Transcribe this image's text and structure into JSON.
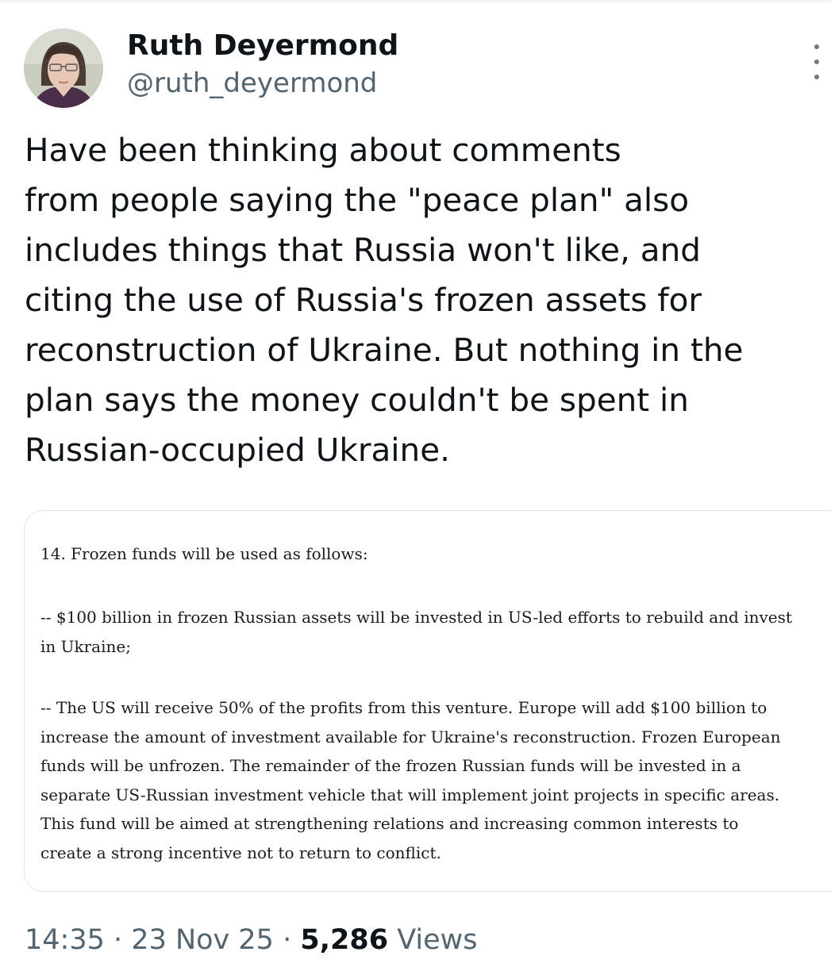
{
  "author": {
    "name": "Ruth Deyermond",
    "handle": "@ruth_deyermond"
  },
  "tweet": {
    "text": "Have been thinking about comments\nfrom people saying the \"peace plan\" also\nincludes things that Russia won't like, and\nciting the use of Russia's frozen assets for\nreconstruction of Ukraine. But nothing in the\nplan says the money couldn't be spent in\nRussian-occupied Ukraine."
  },
  "quoted_image": {
    "heading": "14. Frozen funds will be used as follows:",
    "paragraph1": "-- $100 billion in frozen Russian assets will be invested in US-led efforts to rebuild and invest in Ukraine;",
    "paragraph2": "-- The US will receive 50% of the profits from this venture. Europe will add $100 billion to increase the amount of investment available for Ukraine's reconstruction. Frozen European funds will be unfrozen. The remainder of the frozen Russian funds will be invested in a separate US-Russian investment vehicle that will implement joint projects in specific areas. This fund will be aimed at strengthening relations and increasing common interests to create a strong incentive not to return to conflict."
  },
  "meta": {
    "time": "14:35",
    "separator": "·",
    "date": "23 Nov 25",
    "views_count": "5,286",
    "views_label": "Views"
  },
  "icons": {
    "more": "more-vertical-icon"
  }
}
